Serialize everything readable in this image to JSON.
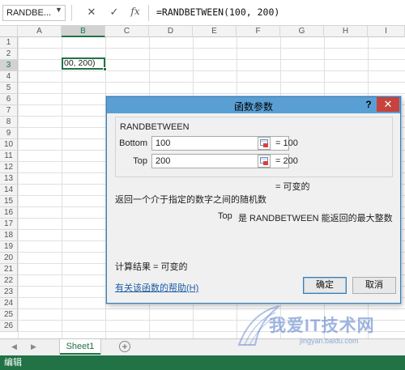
{
  "formula_bar": {
    "name_box": "RANDBE...",
    "cancel_icon": "✕",
    "enter_icon": "✓",
    "fx_label": "fx",
    "formula": "=RANDBETWEEN(100, 200)"
  },
  "grid": {
    "columns": [
      "A",
      "B",
      "C",
      "D",
      "E",
      "F",
      "G",
      "H",
      "I"
    ],
    "selected_column": "B",
    "rows": [
      "1",
      "2",
      "3",
      "4",
      "5",
      "6",
      "7",
      "8",
      "9",
      "10",
      "11",
      "12",
      "13",
      "14",
      "15",
      "16",
      "17",
      "18",
      "19",
      "20",
      "21",
      "22",
      "23",
      "24",
      "25",
      "26"
    ],
    "selected_row": "3",
    "active_cell_text": "00, 200)"
  },
  "sheet_tabs": {
    "prev_icon": "◀",
    "next_icon": "▶",
    "active_sheet": "Sheet1",
    "add_icon": "⊕"
  },
  "status_bar": {
    "mode": "编辑"
  },
  "dialog": {
    "title": "函数参数",
    "help_icon": "?",
    "close_icon": "✕",
    "function_name": "RANDBETWEEN",
    "args": [
      {
        "label": "Bottom",
        "value": "100",
        "result": "= 100"
      },
      {
        "label": "Top",
        "value": "200",
        "result": "= 200"
      }
    ],
    "formula_result": "= 可变的",
    "description": "返回一个介于指定的数字之间的随机数",
    "arg_desc_name": "Top",
    "arg_desc_text": "是 RANDBETWEEN 能返回的最大整数",
    "calc_result": "计算结果 = 可变的",
    "help_link": "有关该函数的帮助(H)",
    "ok": "确定",
    "cancel": "取消"
  },
  "watermark": {
    "text": "我爱IT技术网",
    "url": "jingyan.baidu.com"
  },
  "colors": {
    "excel_green": "#217346",
    "dialog_title": "#5a9fd4",
    "close_red": "#c7433b"
  }
}
